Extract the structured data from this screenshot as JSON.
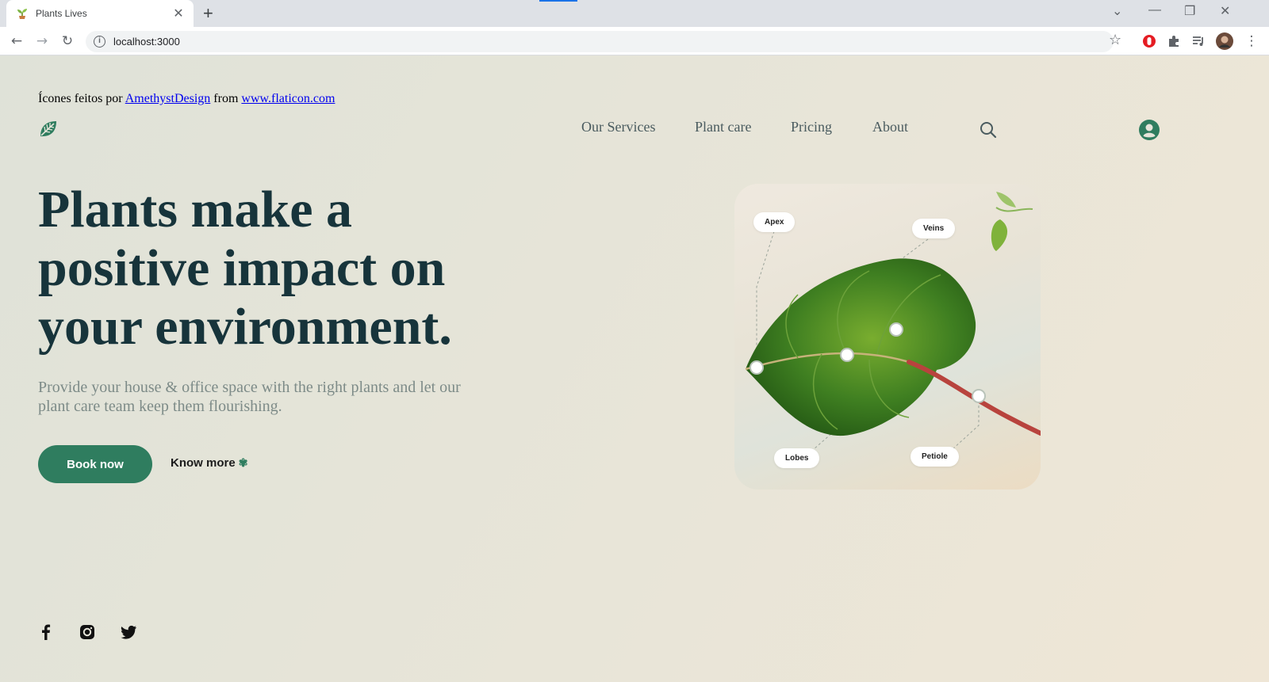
{
  "browser": {
    "tab_title": "Plants Lives",
    "url": "localhost:3000",
    "new_tab": "+",
    "tab_close": "✕"
  },
  "credit": {
    "prefix": "Ícones feitos por ",
    "author": "AmethystDesign",
    "middle": " from ",
    "site": "www.flaticon.com"
  },
  "nav": {
    "items": [
      "Our Services",
      "Plant care",
      "Pricing",
      "About"
    ]
  },
  "hero": {
    "headline_lines": [
      "Plants make a",
      "positive impact on",
      "your environment."
    ],
    "subtext": "Provide your house & office space with the right plants and let our plant care team keep them flourishing.",
    "book_label": "Book now",
    "know_more_label": "Know more"
  },
  "leaf_card": {
    "labels": {
      "apex": "Apex",
      "veins": "Veins",
      "lobes": "Lobes",
      "petiole": "Petiole"
    }
  },
  "icons": {
    "logo": "leaf-logo-icon",
    "search": "search-icon",
    "user": "user-circle-icon",
    "social": [
      "facebook-icon",
      "instagram-icon",
      "twitter-icon"
    ]
  },
  "colors": {
    "accent": "#2f7d5f",
    "headline": "#17343b",
    "nav_text": "#4a5b5f",
    "subtext": "#7d8b88"
  }
}
